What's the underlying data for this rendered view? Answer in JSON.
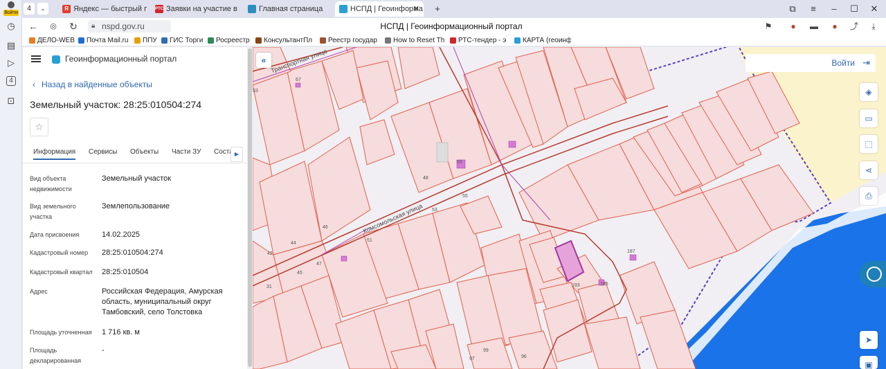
{
  "browser": {
    "profile_label": "Войти",
    "tab_count": "4",
    "tabs": [
      {
        "title": "Яндекс — быстрый пои",
        "icon_color": "#e43b2c"
      },
      {
        "title": "Заявки на участие в п",
        "icon_color": "#d4242c",
        "icon_text": "РТС"
      },
      {
        "title": "Главная страница",
        "icon_color": "#2c8fbd"
      },
      {
        "title": "НСПД | Геоинформа",
        "icon_color": "#2a9fd6"
      }
    ],
    "url": "nspd.gov.ru",
    "page_title": "НСПД | Геоинформационный портал",
    "bookmarks": [
      {
        "label": "ДЕЛО-WEB",
        "color": "#e67e22"
      },
      {
        "label": "Почта Mail.ru",
        "color": "#1f6fd1"
      },
      {
        "label": "ППУ",
        "color": "#e6a000"
      },
      {
        "label": "ГИС Торги",
        "color": "#2f6db5"
      },
      {
        "label": "Росреестр",
        "color": "#2e8b57"
      },
      {
        "label": "КонсультантПл",
        "color": "#8b4513"
      },
      {
        "label": "Реестр государ",
        "color": "#a0522d"
      },
      {
        "label": "How to Reset Th",
        "color": "#777777"
      },
      {
        "label": "РТС-тендер - э",
        "color": "#d4242c"
      },
      {
        "label": "КАРТА (геоинф",
        "color": "#2a9fd6"
      }
    ]
  },
  "panel": {
    "portal_title": "Геоинформационный портал",
    "back_link": "Назад в найденные объекты",
    "object_title": "Земельный участок: 28:25:010504:274",
    "tabs": [
      "Информация",
      "Сервисы",
      "Объекты",
      "Части ЗУ",
      "Соста"
    ],
    "properties": [
      {
        "label": "Вид объекта недвижимости",
        "value": "Земельный участок"
      },
      {
        "label": "Вид земельного участка",
        "value": "Землепользование"
      },
      {
        "label": "Дата присвоения",
        "value": "14.02.2025"
      },
      {
        "label": "Кадастровый номер",
        "value": "28:25:010504:274"
      },
      {
        "label": "Кадастровый квартал",
        "value": "28:25:010504"
      },
      {
        "label": "Адрес",
        "value": "Российская Федерация, Амурская область, муниципальный округ Тамбовский, село Толстовка"
      },
      {
        "label": "Площадь уточненная",
        "value": "1 716 кв. м"
      },
      {
        "label": "Площадь декларированная",
        "value": "-"
      }
    ]
  },
  "map": {
    "login_label": "Войти",
    "streets": [
      "Транспортная улица",
      "Комсомольская улица"
    ],
    "parcel_numbers": [
      "67",
      "53",
      "48",
      "55",
      "53",
      "46",
      "44",
      "42",
      "51",
      "47",
      "45",
      "35",
      "31",
      "187",
      "193",
      "185",
      "99",
      "97",
      "96",
      "59"
    ],
    "colors": {
      "parcel_fill": "#f6dcdc",
      "parcel_stroke": "#e0604e",
      "water": "#1a73e8",
      "yellow_zone": "#faf3cc",
      "selected": "#c060c0"
    }
  }
}
